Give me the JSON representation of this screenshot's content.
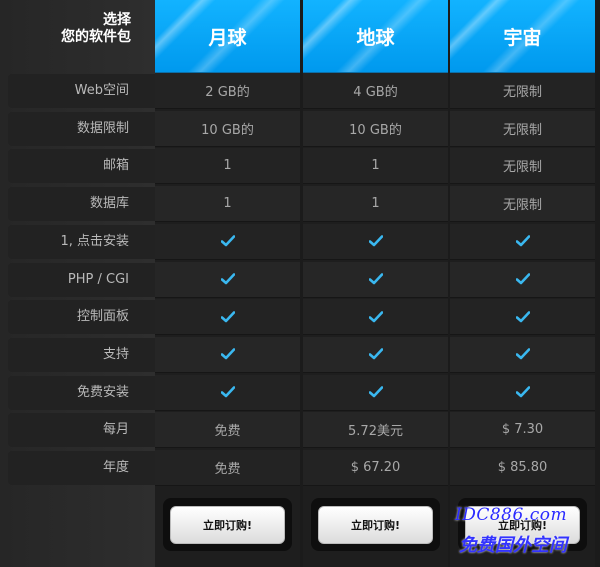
{
  "corner": {
    "line1": "选择",
    "line2": "您的软件包"
  },
  "plans": [
    {
      "name": "月球",
      "cells": [
        "2 GB的",
        "10 GB的",
        "1",
        "1",
        "✓",
        "✓",
        "✓",
        "✓",
        "✓",
        "免费",
        "免费"
      ],
      "button": "立即订购!"
    },
    {
      "name": "地球",
      "cells": [
        "4 GB的",
        "10 GB的",
        "1",
        "1",
        "✓",
        "✓",
        "✓",
        "✓",
        "✓",
        "5.72美元",
        "$ 67.20"
      ],
      "button": "立即订购!"
    },
    {
      "name": "宇宙",
      "cells": [
        "无限制",
        "无限制",
        "无限制",
        "无限制",
        "✓",
        "✓",
        "✓",
        "✓",
        "✓",
        "$ 7.30",
        "$ 85.80"
      ],
      "button": "立即订购!"
    }
  ],
  "features": [
    "Web空间",
    "数据限制",
    "邮箱",
    "数据库",
    "1, 点击安装",
    "PHP / CGI",
    "控制面板",
    "支持",
    "免费安装",
    "每月",
    "年度"
  ],
  "colors": {
    "header_blue": "#0aa6f5",
    "check": "#3ab8f0"
  },
  "watermark": {
    "line1": "IDC886.com",
    "line2": "免费国外空间"
  }
}
